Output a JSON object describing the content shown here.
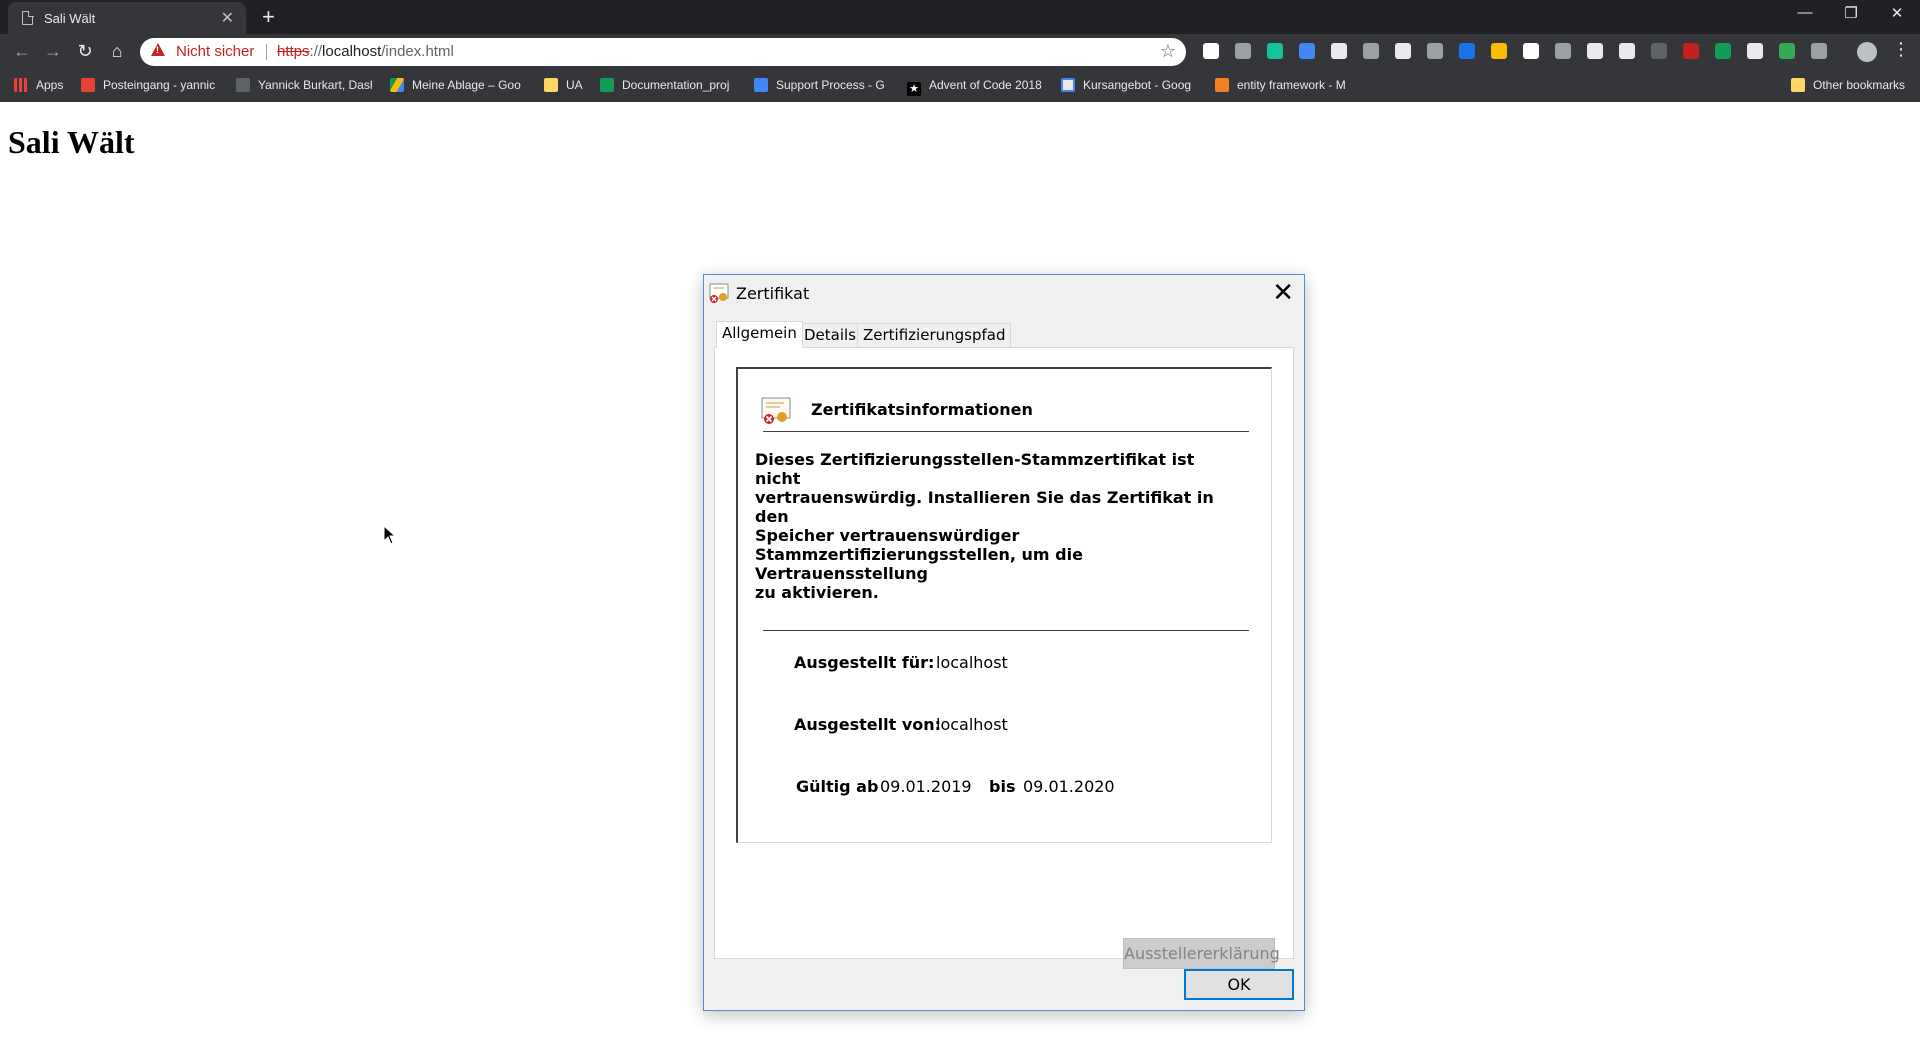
{
  "browser": {
    "tab_title": "Sali Wält",
    "new_tab": "+",
    "omnibox": {
      "security_status": "Nicht sicher",
      "url_scheme": "https",
      "url_rest": "://",
      "url_host": "localhost",
      "url_path": "/index.html"
    },
    "bookmarks": [
      {
        "label": "Apps",
        "color": "#ea4335"
      },
      {
        "label": "Posteingang - yannic",
        "color": "#ea4335"
      },
      {
        "label": "Yannick Burkart, Dash",
        "color": "#202124"
      },
      {
        "label": "Meine Ablage – Goo",
        "color": "#fbbc04"
      },
      {
        "label": "UA",
        "color": "#fdd663"
      },
      {
        "label": "Documentation_proj",
        "color": "#0f9d58"
      },
      {
        "label": "Support Process - G",
        "color": "#4285f4"
      },
      {
        "label": "Advent of Code 2018",
        "color": "#202124"
      },
      {
        "label": "Kursangebot - Goog",
        "color": "#4285f4"
      },
      {
        "label": "entity framework - M",
        "color": "#f48024"
      }
    ],
    "other_bookmarks": "Other bookmarks",
    "extension_colors": [
      "#ffffff",
      "#9aa0a6",
      "#15c39a",
      "#4285f4",
      "#e8eaed",
      "#9aa0a6",
      "#e8eaed",
      "#9aa0a6",
      "#1a73e8",
      "#fbbc04",
      "#ffffff",
      "#9aa0a6",
      "#e8eaed",
      "#e8eaed",
      "#5f6368",
      "#c5221f",
      "#0f9d58",
      "#e8eaed",
      "#34a853",
      "#9aa0a6"
    ]
  },
  "page": {
    "heading": "Sali Wält"
  },
  "dialog": {
    "title": "Zertifikat",
    "tabs": [
      "Allgemein",
      "Details",
      "Zertifizierungspfad"
    ],
    "info_heading": "Zertifikatsinformationen",
    "message_lines": [
      "Dieses Zertifizierungsstellen-Stammzertifikat ist nicht",
      "vertrauenswürdig. Installieren Sie das Zertifikat in den",
      "Speicher vertrauenswürdiger",
      "Stammzertifizierungsstellen, um die Vertrauensstellung",
      "zu aktivieren."
    ],
    "issued_to_label": "Ausgestellt für:",
    "issued_to_value": "localhost",
    "issued_by_label": "Ausgestellt von:",
    "issued_by_value": "localhost",
    "valid_from_label": "Gültig ab",
    "valid_from_value": "09.01.2019",
    "valid_to_label": "bis",
    "valid_to_value": "09.01.2020",
    "issuer_statement_button": "Ausstellererklärung",
    "ok_button": "OK"
  }
}
